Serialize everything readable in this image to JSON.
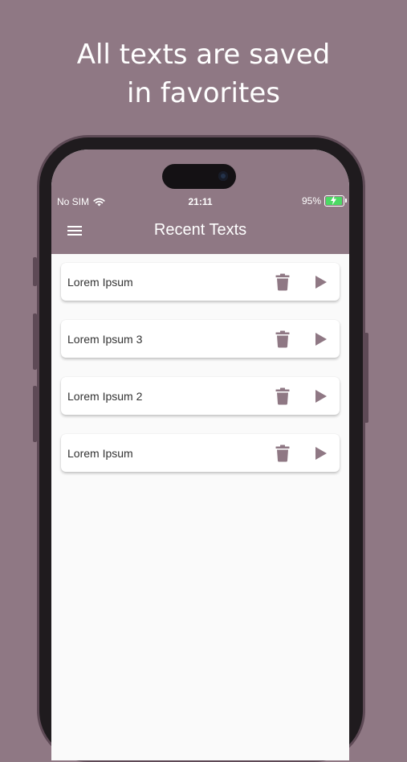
{
  "promo": {
    "headline_line1": "All texts are saved",
    "headline_line2": "in favorites"
  },
  "status_bar": {
    "carrier": "No SIM",
    "time": "21:11",
    "battery": "95%",
    "battery_level": 0.95,
    "charging": true
  },
  "app_bar": {
    "title": "Recent Texts",
    "menu_icon": "hamburger-menu-icon"
  },
  "texts": [
    {
      "label": "Lorem Ipsum",
      "delete_icon": "trash-icon",
      "play_icon": "play-icon"
    },
    {
      "label": "Lorem Ipsum 3",
      "delete_icon": "trash-icon",
      "play_icon": "play-icon"
    },
    {
      "label": "Lorem Ipsum 2",
      "delete_icon": "trash-icon",
      "play_icon": "play-icon"
    },
    {
      "label": "Lorem Ipsum",
      "delete_icon": "trash-icon",
      "play_icon": "play-icon"
    }
  ],
  "colors": {
    "brand": "#8f7884",
    "icon": "#8f7884",
    "list_background": "#fafafa",
    "battery_fill": "#4cd964"
  }
}
